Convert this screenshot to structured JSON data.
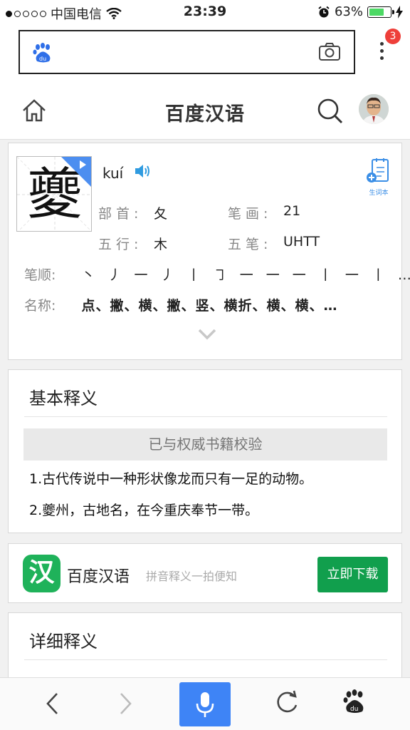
{
  "status_bar": {
    "carrier": "中国电信",
    "time": "23:39",
    "battery": "63%",
    "battery_level": 0.63
  },
  "browser": {
    "notification_count": "3"
  },
  "header": {
    "title": "百度汉语"
  },
  "character": {
    "glyph": "夔",
    "pinyin": "kuí",
    "vocab_label": "生词本",
    "radical_label": "部首:",
    "radical": "夂",
    "strokes_label": "笔画:",
    "stroke_count": "21",
    "wuxing_label": "五行:",
    "wuxing": "木",
    "wubi_label": "五笔:",
    "wubi": "UHTT",
    "order_label": "笔顺:",
    "order": "丶 丿 一 丿 丨 ㇆ 一 一 一 丨 一 丨 …",
    "names_label": "名称:",
    "names": "点、撇、横、撇、竖、横折、横、横、…"
  },
  "basic": {
    "title": "基本释义",
    "verified": "已与权威书籍校验",
    "definitions": [
      "1.古代传说中一种形状像龙而只有一足的动物。",
      "2.夔州，古地名，在今重庆奉节一带。"
    ]
  },
  "promo": {
    "icon_char": "汉",
    "app_name": "百度汉语",
    "tagline": "拼音释义一拍便知",
    "button": "立即下载"
  },
  "detail": {
    "title": "详细释义"
  }
}
